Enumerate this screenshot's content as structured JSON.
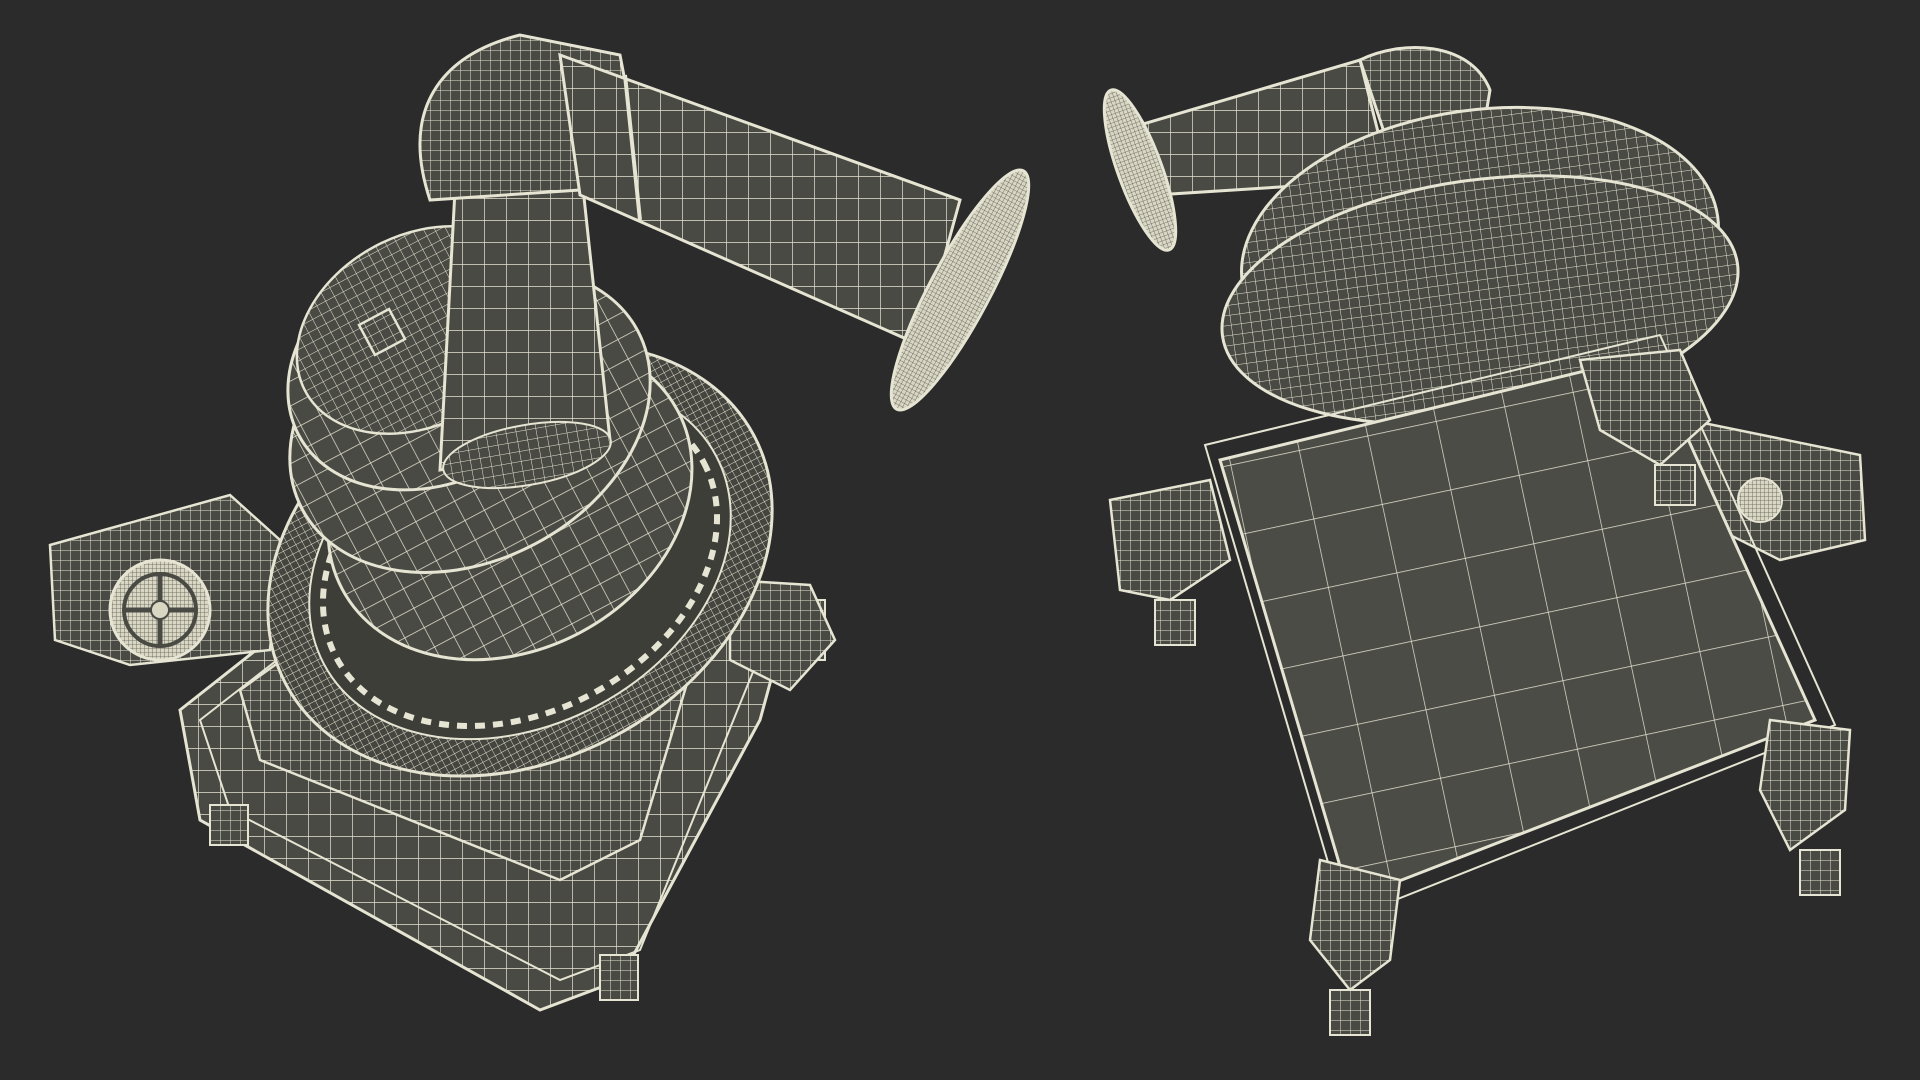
{
  "scene": {
    "background_color": "#2b2b2b",
    "mesh_fill_color": "#4a4a44",
    "mesh_wire_color": "#e6e4d2",
    "mesh_shadow_color": "#3c3c36",
    "views": [
      {
        "id": "top-iso",
        "subject": "wireframe-pot-still-model"
      },
      {
        "id": "bottom-iso",
        "subject": "wireframe-pot-still-model"
      }
    ]
  }
}
